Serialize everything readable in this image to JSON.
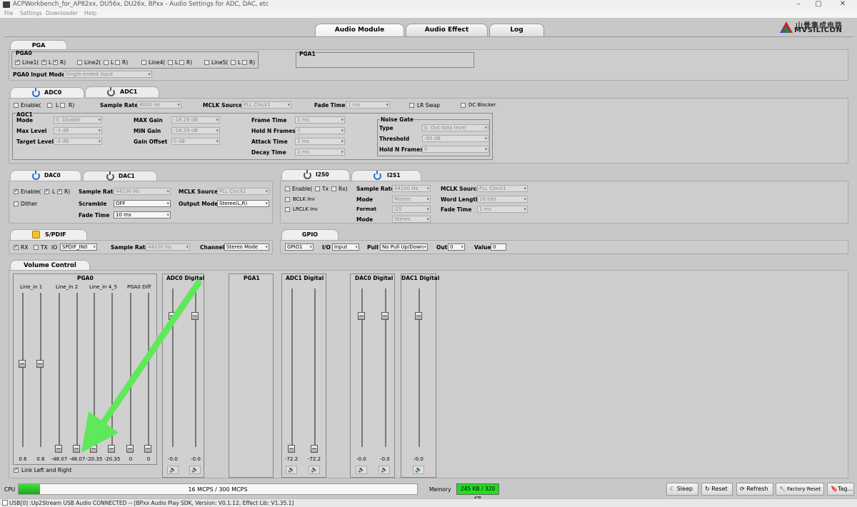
{
  "window": {
    "title": "ACPWorkbench_for_AP82xx, DU56x, DU26x, BPxx - Audio Settings for ADC, DAC, etc",
    "menu": [
      "File",
      "Settings",
      "Downloader",
      "Help"
    ]
  },
  "main_tabs": [
    "Audio Module",
    "Audio Effect",
    "Log"
  ],
  "logo": {
    "cn": "山景集成电路",
    "en": "MVSILICON"
  },
  "pga": {
    "tab": "PGA",
    "pga0_title": "PGA0",
    "pga1_title": "PGA1",
    "line1": "Line1(",
    "line2": "Line2(",
    "line4": "Line4(",
    "line5": "Line5(",
    "l": "L",
    "r": "R)",
    "input_mode_label": "PGA0 Input Mode",
    "input_mode_value": "Single-ended input"
  },
  "adc": {
    "tabs": [
      "ADC0",
      "ADC1"
    ],
    "enable": "Enable(",
    "l": "L",
    "r": "R)",
    "sample_rate_label": "Sample Rate",
    "sample_rate": "8000 Hz",
    "mclk_label": "MCLK Source",
    "mclk": "PLL Clock1",
    "fade_label": "Fade Time",
    "fade": "1 ms",
    "lr_swap": "LR Swap",
    "dc_blocker": "DC Blocker",
    "agc_title": "AGC1",
    "mode_label": "Mode",
    "mode": "0. Disable",
    "max_level_label": "Max Level",
    "max_level": "-3 dB",
    "target_level_label": "Target Level",
    "target_level": "-3 dB",
    "max_gain_label": "MAX Gain",
    "max_gain": "-18.29 dB",
    "min_gain_label": "MIN Gain",
    "min_gain": "-18.29 dB",
    "gain_offset_label": "Gain Offset",
    "gain_offset": "0 dB",
    "frame_time_label": "Frame Time",
    "frame_time": "1 ms",
    "hold_frames_label": "Hold N Frames",
    "hold_frames": "0",
    "attack_label": "Attack Time",
    "attack": "1 ms",
    "decay_label": "Decay Time",
    "decay": "1 ms",
    "ng_title": "Noise Gate",
    "ng_type_label": "Type",
    "ng_type": "0. Out data level",
    "ng_threshold_label": "Threshold",
    "ng_threshold": "-90 dB",
    "ng_hold_label": "Hold N Frames",
    "ng_hold": "0"
  },
  "dac": {
    "tabs": [
      "DAC0",
      "DAC1"
    ],
    "enable": "Enable(",
    "l": "L",
    "r": "R)",
    "dither": "Dither",
    "sample_rate_label": "Sample Rate",
    "sample_rate": "44100 Hz",
    "scramble_label": "Scramble",
    "scramble": "OFF",
    "fade_label": "Fade Time",
    "fade": "10 ms",
    "mclk_label": "MCLK Source",
    "mclk": "PLL Clock1",
    "output_mode_label": "Output Mode",
    "output_mode": "Stereo(L,R)"
  },
  "i2s": {
    "tabs": [
      "I2S0",
      "I2S1"
    ],
    "enable": "Enable(",
    "tx": "Tx",
    "rx": "Rx)",
    "bclk_inv": "BCLK Inv",
    "lrclk_inv": "LRCLK Inv",
    "sample_rate_label": "Sample Rate",
    "sample_rate": "44100 Hz",
    "mode_label": "Mode",
    "mode": "Master",
    "format_label": "Format",
    "format": "I2S",
    "mode2_label": "Mode",
    "mode2": "Stereo",
    "mclk_label": "MCLK Source",
    "mclk": "PLL Clock1",
    "word_length_label": "Word Length",
    "word_length": "16 bits",
    "fade_label": "Fade Time",
    "fade": "1 ms"
  },
  "spdif": {
    "tab": "S/PDIF",
    "rx": "RX",
    "tx": "TX",
    "io_label": "IO",
    "io": "SPDIF_IN0",
    "sample_rate_label": "Sample Rate",
    "sample_rate": "44100 Hz",
    "channel_label": "Channel",
    "channel": "Stereo Mode"
  },
  "gpio": {
    "tab": "GPIO",
    "pin": "GPIO1",
    "io_label": "I/O",
    "io": "Input",
    "pull_label": "Pull",
    "pull": "No Pull Up/Down",
    "out_label": "Out",
    "out": "0",
    "value_label": "Value",
    "value": "0"
  },
  "volume": {
    "tab": "Volume Control",
    "pga0_title": "PGA0",
    "channel_labels": [
      "Line_in 1",
      "Line_in 2",
      "Line_in 4_5",
      "PGA0 Diff"
    ],
    "pga0_values": [
      "0.6",
      "0.6",
      "-48.07",
      "-48.07",
      "-20.35",
      "-20.35",
      "0",
      "0"
    ],
    "pga0_levels": [
      0.55,
      0.55,
      0.0,
      0.0,
      0.0,
      0.0,
      0.0,
      0.0
    ],
    "adc0_title": "ADC0 Digital",
    "adc0_values": [
      "-0.0",
      "-0.0"
    ],
    "pga1_title": "PGA1",
    "adc1_title": "ADC1 Digital",
    "adc1_values": [
      "-72.2",
      "-72.2"
    ],
    "dac0_title": "DAC0 Digital",
    "dac0_values": [
      "-0.0",
      "-0.0"
    ],
    "dac1_title": "DAC1 Digital",
    "dac1_values": [
      "-0.0"
    ],
    "link": "Link Left and Right"
  },
  "bottom": {
    "cpu_label": "CPU",
    "cpu_text": "16 MCPS / 300 MCPS",
    "cpu_fraction": 0.053,
    "memory_label": "Memory",
    "memory_text": "245 KB / 320 KB",
    "buttons": [
      "Sleep",
      "Reset",
      "Refresh",
      "Factory Reset",
      "Tag..."
    ]
  },
  "status": "USB[0] :Up2Stream USB Audio CONNECTED -- [BPxx Audio Play SDK,  Version: V0.1.12,  Effect Lib: V1.35.1]",
  "colors": {
    "accent_blue": "#2b6fd6",
    "memory_green": "#22dd22",
    "arrow_green": "#5ee85a"
  }
}
